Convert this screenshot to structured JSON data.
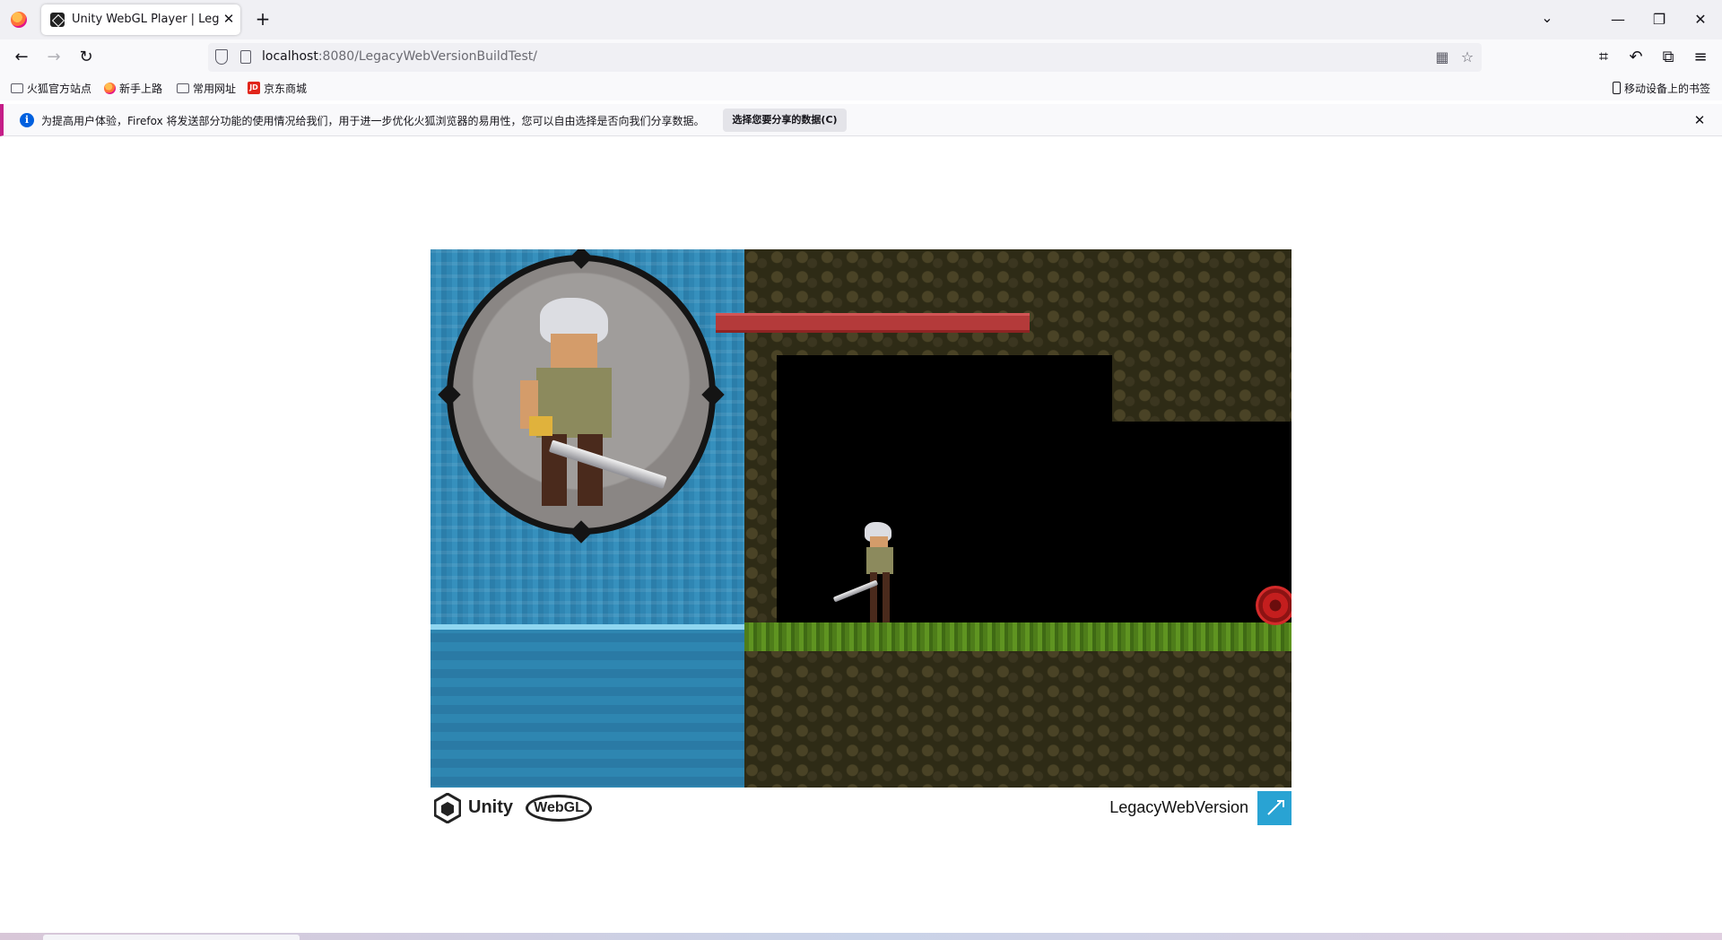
{
  "browser": {
    "tab_title": "Unity WebGL Player | LegacyWebVersion",
    "tab_close": "✕",
    "new_tab": "+",
    "url_host": "localhost",
    "url_rest": ":8080/LegacyWebVersionBuildTest/",
    "bookmarks": [
      "火狐官方站点",
      "新手上路",
      "常用网址",
      "京东商城"
    ],
    "mobile_bookmarks": "移动设备上的书签"
  },
  "notification": {
    "text": "为提高用户体验，Firefox 将发送部分功能的使用情况给我们，用于进一步优化火狐浏览器的易用性，您可以自由选择是否向我们分享数据。",
    "button": "选择您要分享的数据(C)",
    "close": "✕"
  },
  "game": {
    "health_fraction": 1.0
  },
  "footer": {
    "unity_label": "Unity",
    "webgl_label": "WebGL",
    "build_title": "LegacyWebVersion"
  },
  "colors": {
    "accent": "#29a3d3",
    "notification_bar": "#c51e88",
    "health": "#b43a3a"
  },
  "icons": [
    "firefox-icon",
    "unity-tab-icon",
    "back-icon",
    "forward-icon",
    "reload-icon",
    "shield-icon",
    "page-icon",
    "qr-code-icon",
    "star-icon",
    "screenshot-icon",
    "undo-icon",
    "extensions-icon",
    "menu-icon",
    "folder-icon",
    "jd-icon",
    "phone-icon",
    "info-icon",
    "unity-logo-icon",
    "fullscreen-icon"
  ]
}
